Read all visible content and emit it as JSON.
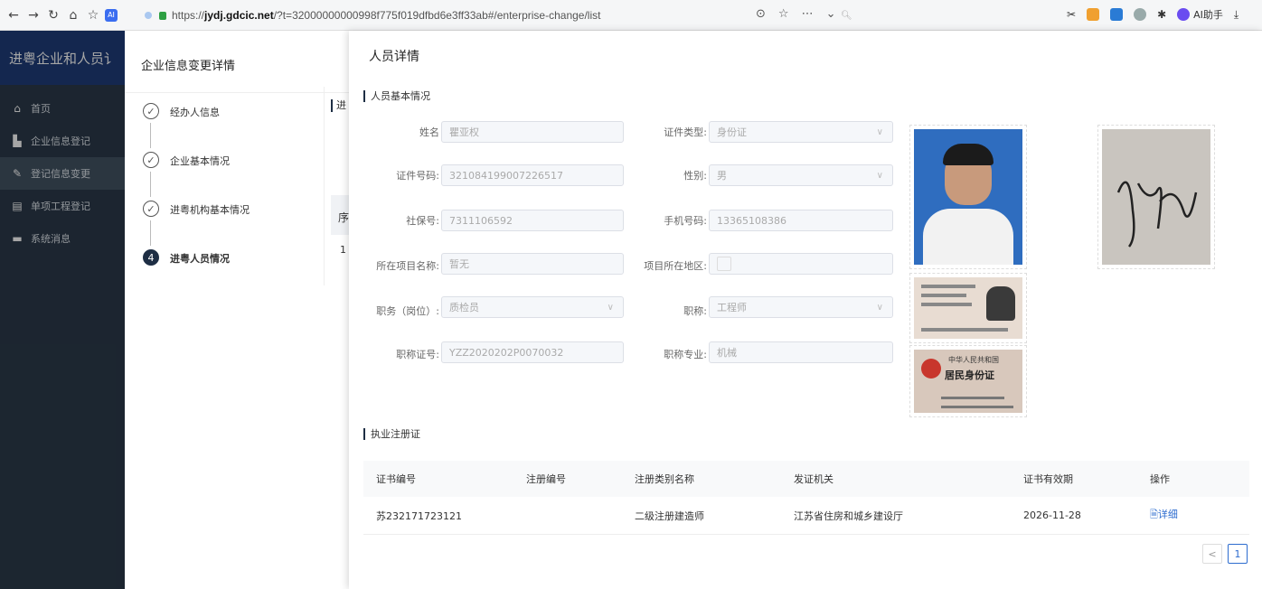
{
  "browser": {
    "url_prefix": "https://",
    "url_host": "jydj.gdcic.net",
    "url_rest": "/?t=32000000000998f775f019dfbd6e3ff33ab#/enterprise-change/list",
    "search_placeholder": "",
    "ai_badge": "AI",
    "ai_helper_label": "AI助手"
  },
  "sidebar": {
    "title": "进粤企业和人员讠",
    "items": [
      {
        "label": "首页"
      },
      {
        "label": "企业信息登记"
      },
      {
        "label": "登记信息变更"
      },
      {
        "label": "单项工程登记"
      },
      {
        "label": "系统消息"
      }
    ]
  },
  "change_drawer": {
    "title": "企业信息变更详情",
    "steps": [
      {
        "label": "经办人信息",
        "state": "done"
      },
      {
        "label": "企业基本情况",
        "state": "done"
      },
      {
        "label": "进粤机构基本情况",
        "state": "done"
      },
      {
        "label": "进粤人员情况",
        "state": "current",
        "number": "4"
      }
    ],
    "peek_section": "进",
    "peek_col": "序",
    "peek_num": "1"
  },
  "detail_drawer": {
    "title": "人员详情",
    "basic_section": "人员基本情况",
    "fields": {
      "name_label": "姓名",
      "name_value": "瞿亚权",
      "id_type_label": "证件类型:",
      "id_type_value": "身份证",
      "id_no_label": "证件号码:",
      "id_no_value": "321084199007226517",
      "gender_label": "性别:",
      "gender_value": "男",
      "social_label": "社保号:",
      "social_value": "7311106592",
      "phone_label": "手机号码:",
      "phone_value": "13365108386",
      "project_label": "所在项目名称:",
      "project_value": "暂无",
      "region_label": "项目所在地区:",
      "region_value": "",
      "position_label": "职务（岗位）:",
      "position_value": "质检员",
      "title_label": "职称:",
      "title_value": "工程师",
      "title_cert_label": "职称证号:",
      "title_cert_value": "YZZ2020202P0070032",
      "title_major_label": "职称专业:",
      "title_major_value": "机械"
    },
    "id_card_back": {
      "line1": "中华人民共和国",
      "line2": "居民身份证"
    },
    "reg_section": "执业注册证",
    "table": {
      "headers": [
        "证书编号",
        "注册编号",
        "注册类别名称",
        "发证机关",
        "证书有效期",
        "操作"
      ],
      "rows": [
        {
          "cert_no": "苏2321717231­21",
          "reg_no": "",
          "category": "二级注册建造师",
          "issuer": "江苏省住房和城乡建设厅",
          "valid": "2026-11-28",
          "action": "详细"
        }
      ]
    },
    "pager": {
      "prev": "<",
      "page": "1"
    }
  }
}
